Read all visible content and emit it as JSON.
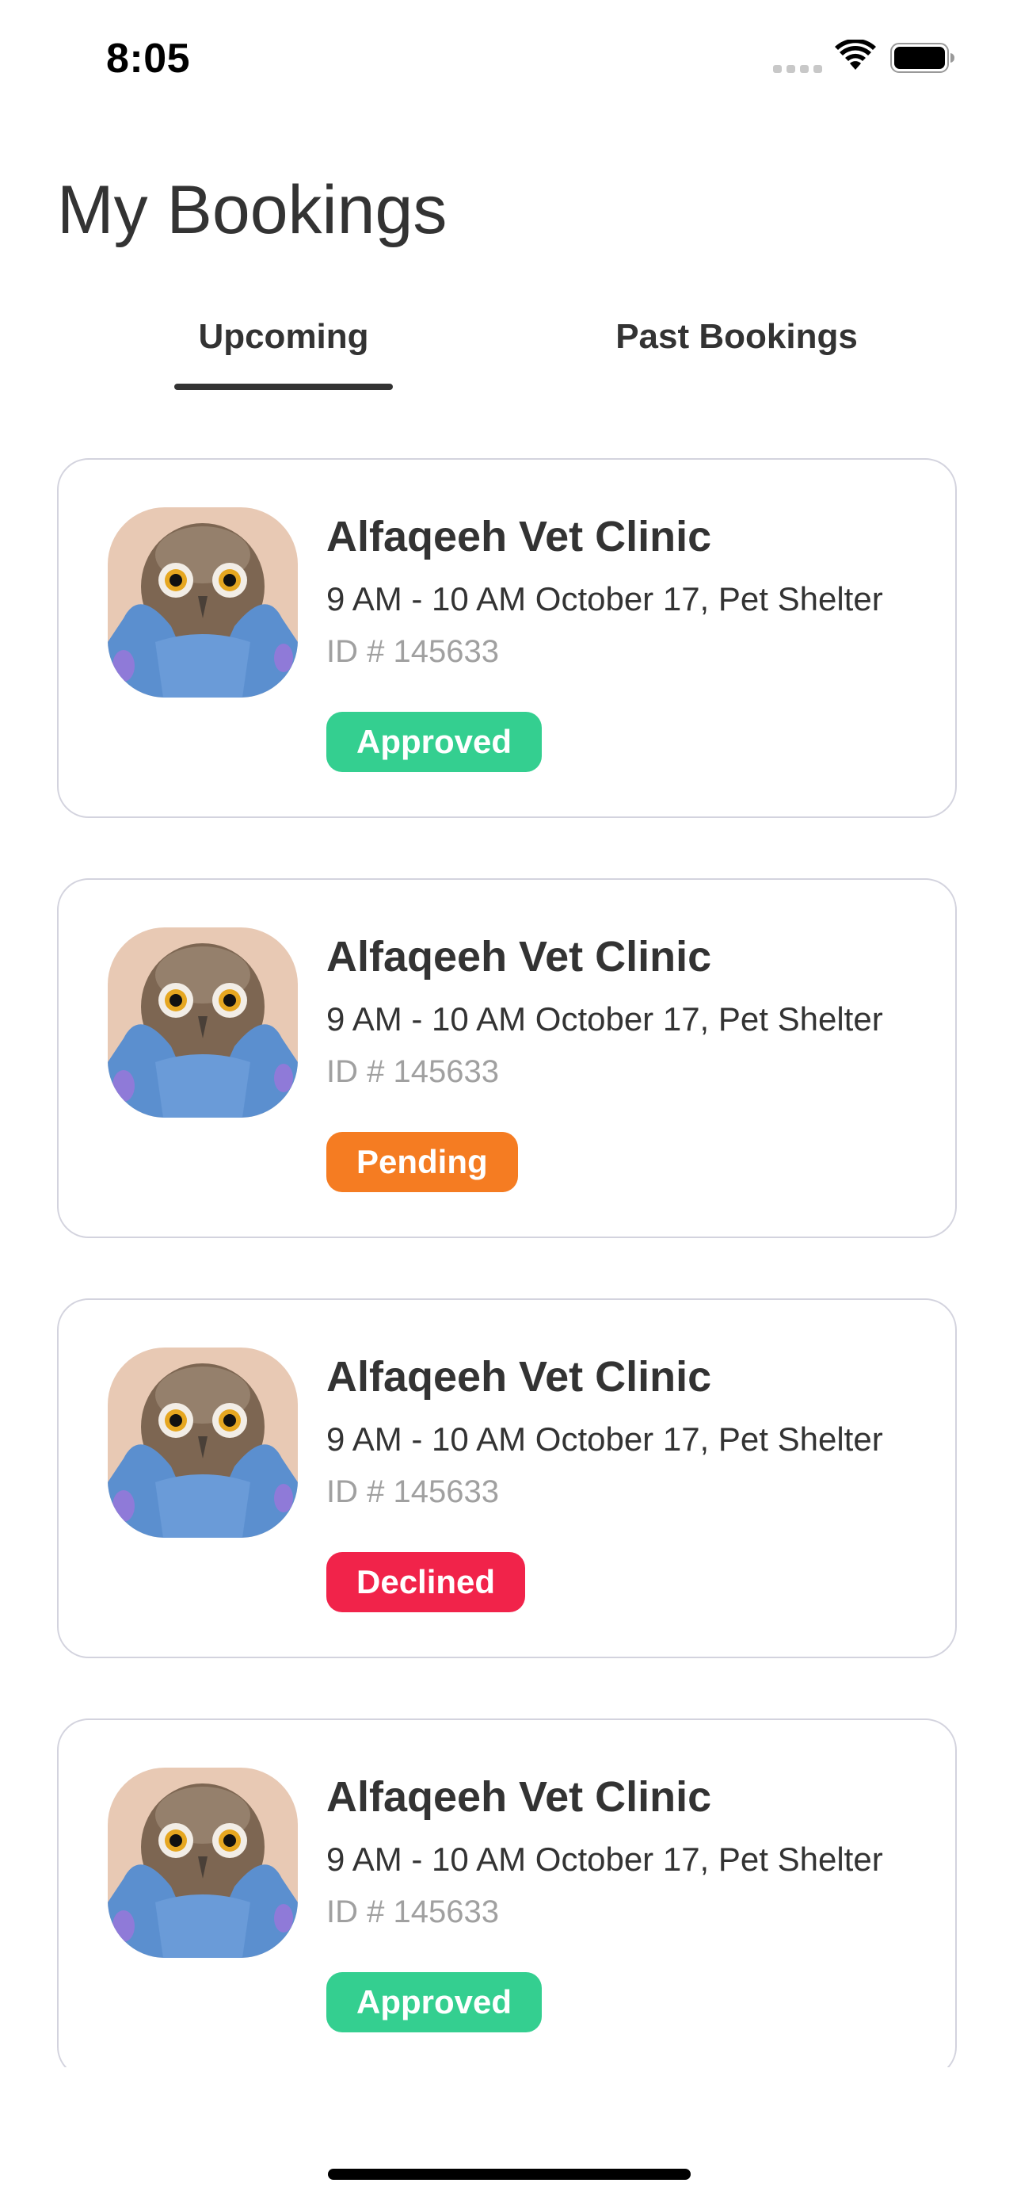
{
  "status_bar": {
    "time": "8:05"
  },
  "page": {
    "title": "My Bookings"
  },
  "tabs": [
    {
      "label": "Upcoming",
      "active": true
    },
    {
      "label": "Past Bookings",
      "active": false
    }
  ],
  "bookings": [
    {
      "clinic": "Alfaqeeh Vet Clinic",
      "time": "9 AM - 10 AM October 17, Pet Shelter",
      "id": "ID # 145633",
      "status": "Approved",
      "status_color": "#34cf90"
    },
    {
      "clinic": "Alfaqeeh Vet Clinic",
      "time": "9 AM - 10 AM October 17, Pet Shelter",
      "id": "ID # 145633",
      "status": "Pending",
      "status_color": "#f57c22"
    },
    {
      "clinic": "Alfaqeeh Vet Clinic",
      "time": "9 AM - 10 AM October 17, Pet Shelter",
      "id": "ID # 145633",
      "status": "Declined",
      "status_color": "#f1234a"
    },
    {
      "clinic": "Alfaqeeh Vet Clinic",
      "time": "9 AM - 10 AM October 17, Pet Shelter",
      "id": "ID # 145633",
      "status": "Approved",
      "status_color": "#34cf90"
    }
  ],
  "icons": {
    "signal": "cellular-signal-icon",
    "wifi": "wifi-icon",
    "battery": "battery-icon",
    "avatar": "owl-photo"
  }
}
